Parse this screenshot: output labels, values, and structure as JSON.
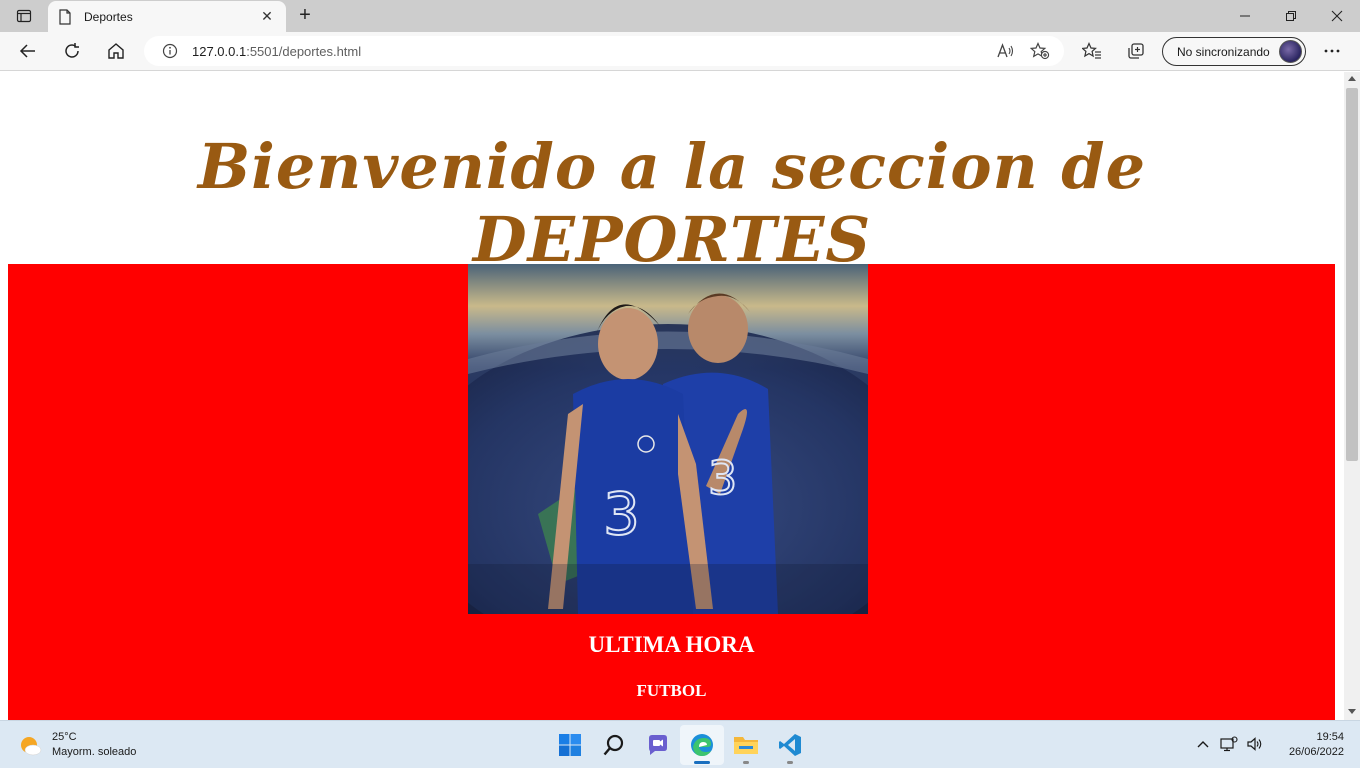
{
  "browser": {
    "tab": {
      "title": "Deportes"
    },
    "address": {
      "host": "127.0.0.1",
      "rest": ":5501/deportes.html"
    },
    "profile": {
      "label": "No sincronizando"
    }
  },
  "page": {
    "heading": "Bienvenido a la seccion de DEPORTES",
    "section_color": "#ff0000",
    "heading_color": "#995a12",
    "news_heading": "ULTIMA HORA",
    "news_subheading": "FUTBOL"
  },
  "taskbar": {
    "weather": {
      "temp": "25°C",
      "condition": "Mayorm. soleado"
    },
    "apps": [
      "start-icon",
      "search-icon",
      "chat-icon",
      "edge-icon",
      "file-explorer-icon",
      "vscode-icon"
    ],
    "clock": {
      "time": "19:54",
      "date": "26/06/2022"
    }
  }
}
